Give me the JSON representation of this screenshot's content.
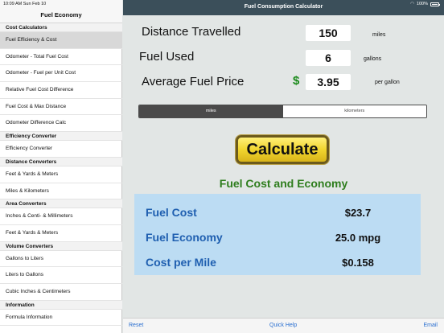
{
  "status": {
    "time_date": "10:09 AM  Sun Feb 10",
    "battery": "100%"
  },
  "sidebar": {
    "title": "Fuel Economy",
    "entries": [
      {
        "type": "section",
        "label": "Cost Calculators"
      },
      {
        "type": "item",
        "label": "Fuel Efficiency & Cost",
        "selected": true
      },
      {
        "type": "item",
        "label": "Odometer - Total Fuel Cost"
      },
      {
        "type": "item",
        "label": "Odometer - Fuel per Unit Cost"
      },
      {
        "type": "item",
        "label": "Relative Fuel Cost Difference"
      },
      {
        "type": "item",
        "label": "Fuel Cost & Max Distance"
      },
      {
        "type": "item",
        "label": "Odometer Difference Calc"
      },
      {
        "type": "section",
        "label": "Efficiency Converter"
      },
      {
        "type": "item",
        "label": "Efficiency Converter"
      },
      {
        "type": "section",
        "label": "Distance Converters"
      },
      {
        "type": "item",
        "label": "Feet & Yards & Meters"
      },
      {
        "type": "item",
        "label": "Miles & Kilometers"
      },
      {
        "type": "section",
        "label": "Area Converters"
      },
      {
        "type": "item",
        "label": "Inches & Centi- & Millimeters"
      },
      {
        "type": "item",
        "label": "Feet & Yards & Meters"
      },
      {
        "type": "section",
        "label": "Volume Converters"
      },
      {
        "type": "item",
        "label": "Gallons to Liters"
      },
      {
        "type": "item",
        "label": "Liters to Gallons"
      },
      {
        "type": "item",
        "label": "Cubic Inches & Centimeters"
      },
      {
        "type": "section",
        "label": "Information"
      },
      {
        "type": "item",
        "label": "Formula Information"
      }
    ]
  },
  "main": {
    "title": "Fuel Consumption Calculator",
    "inputs": {
      "distance": {
        "label": "Distance Travelled",
        "value": "150",
        "unit": "miles"
      },
      "fuel": {
        "label": "Fuel Used",
        "value": "6",
        "unit": "gallons"
      },
      "price": {
        "label": "Average Fuel Price",
        "currency": "$",
        "value": "3.95",
        "unit": "per gallon"
      }
    },
    "segment": {
      "options": [
        "miles",
        "kilometers"
      ],
      "selected": "miles"
    },
    "calculate_label": "Calculate",
    "result_heading": "Fuel Cost and Economy",
    "results": {
      "fuel_cost": {
        "label": "Fuel Cost",
        "value": "$23.7"
      },
      "fuel_economy": {
        "label": "Fuel Economy",
        "value": "25.0 mpg"
      },
      "cost_per_mile": {
        "label": "Cost per Mile",
        "value": "$0.158"
      }
    }
  },
  "bottombar": {
    "reset": "Reset",
    "quick_help": "Quick Help",
    "email": "Email"
  },
  "colors": {
    "topbar": "#3b4f5a",
    "result_heading": "#2e7d1d",
    "result_label": "#1f5fb0",
    "result_panel": "#bcdcf3",
    "calculate_button": "#f1d52f",
    "link": "#2a6fd0"
  }
}
